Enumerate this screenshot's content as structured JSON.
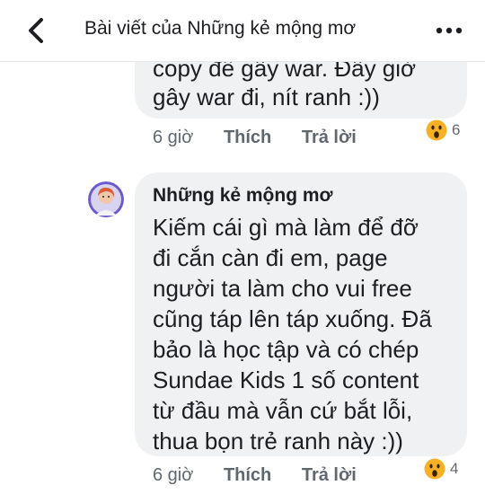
{
  "header": {
    "title": "Bài viết của Những kẻ mộng mơ"
  },
  "comments": [
    {
      "lines": [
        "copy để gây war. Đây giờ",
        "gây war đi, nít ranh :))"
      ],
      "time": "6 giờ",
      "like_label": "Thích",
      "reply_label": "Trả lời",
      "reaction": {
        "icon": "wow-emoji-icon",
        "count": "6"
      }
    },
    {
      "author": "Những kẻ mộng mơ",
      "lines": [
        "Kiếm cái gì mà làm để đỡ",
        "đi cắn càn đi em, page",
        "người ta làm cho vui free",
        "cũng táp lên táp xuống. Đã",
        "bảo là học tập và có chép",
        "Sundae Kids 1 số content",
        "từ đầu mà vẫn cứ bắt lỗi,",
        "thua bọn trẻ ranh này :))"
      ],
      "time": "6 giờ",
      "like_label": "Thích",
      "reply_label": "Trả lời",
      "reaction": {
        "icon": "wow-emoji-icon",
        "count": "4"
      }
    }
  ],
  "colors": {
    "bubble": "#eff1f3",
    "meta_text": "#606770",
    "text": "#1c1e21"
  }
}
